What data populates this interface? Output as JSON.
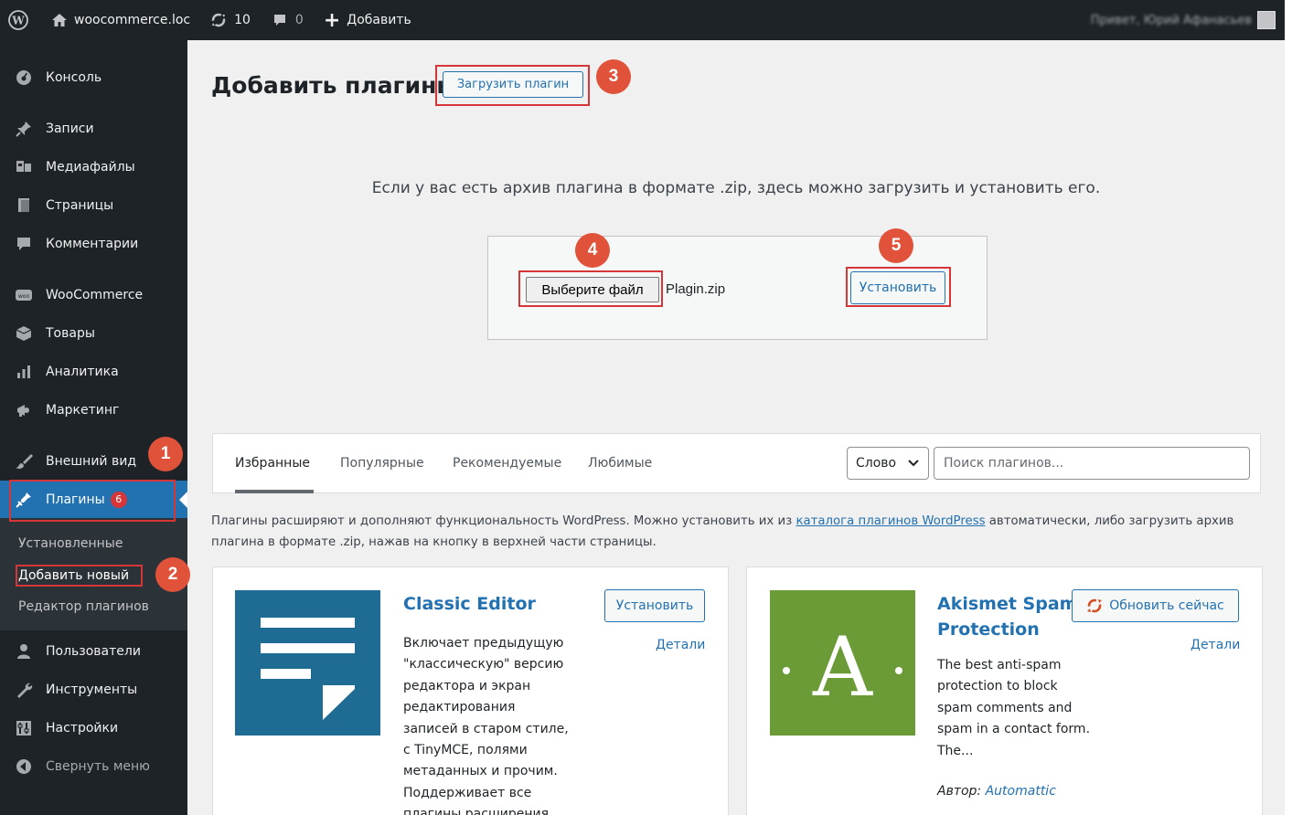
{
  "adminbar": {
    "site_name": "woocommerce.loc",
    "updates_count": "10",
    "comments_count": "0",
    "new_label": "Добавить",
    "greeting": "Привет, Юрий Афанасьев"
  },
  "sidebar": {
    "items": [
      {
        "label": "Консоль",
        "icon": "dashboard-icon"
      },
      {
        "label": "Записи",
        "icon": "pin-icon"
      },
      {
        "label": "Медиафайлы",
        "icon": "media-icon"
      },
      {
        "label": "Страницы",
        "icon": "pages-icon"
      },
      {
        "label": "Комментарии",
        "icon": "comment-icon"
      },
      {
        "label": "WooCommerce",
        "icon": "woo-icon"
      },
      {
        "label": "Товары",
        "icon": "products-icon"
      },
      {
        "label": "Аналитика",
        "icon": "analytics-icon"
      },
      {
        "label": "Маркетинг",
        "icon": "megaphone-icon"
      },
      {
        "label": "Внешний вид",
        "icon": "brush-icon"
      },
      {
        "label": "Плагины",
        "icon": "plugin-icon",
        "badge": "6"
      },
      {
        "label": "Пользователи",
        "icon": "users-icon"
      },
      {
        "label": "Инструменты",
        "icon": "wrench-icon"
      },
      {
        "label": "Настройки",
        "icon": "settings-icon"
      },
      {
        "label": "Свернуть меню",
        "icon": "collapse-icon"
      }
    ],
    "submenu": [
      "Установленные",
      "Добавить новый",
      "Редактор плагинов"
    ]
  },
  "markers": [
    "1",
    "2",
    "3",
    "4",
    "5"
  ],
  "page": {
    "title": "Добавить плагины",
    "upload_button": "Загрузить плагин",
    "upload_description": "Если у вас есть архив плагина в формате .zip, здесь можно загрузить и установить его.",
    "choose_file": "Выберите файл",
    "file_name": "Plagin.zip",
    "install_button": "Установить"
  },
  "filters": {
    "tabs": [
      "Избранные",
      "Популярные",
      "Рекомендуемые",
      "Любимые"
    ],
    "select_value": "Слово",
    "search_placeholder": "Поиск плагинов..."
  },
  "intro": {
    "before": "Плагины расширяют и дополняют функциональность WordPress. Можно установить их из ",
    "link": "каталога плагинов WordPress",
    "after": " автоматически, либо загрузить архив плагина в формате .zip, нажав на кнопку в верхней части страницы."
  },
  "plugins": [
    {
      "title": "Classic Editor",
      "action": "Установить",
      "details": "Детали",
      "description_lines": [
        "Включает предыдущую",
        "\"классическую\" версию",
        "редактора и экран",
        "редактирования",
        "записей в старом стиле,",
        "с TinyMCE, полями",
        "метаданных и прочим.",
        "Поддерживает все",
        "плагины расширения"
      ]
    },
    {
      "title_lines": [
        "Akismet Spam",
        "Protection"
      ],
      "action": "Обновить сейчас",
      "details": "Детали",
      "description_lines": [
        "The best anti-spam",
        "protection to block",
        "spam comments and",
        "spam in a contact form.",
        "The..."
      ],
      "author_label": "Автор:",
      "author": "Automattic"
    }
  ],
  "colors": {
    "sidebar_bg": "#1d2327",
    "accent": "#2271b1",
    "marker": "#e0523a",
    "highlight_box": "#d63638",
    "classic_editor_tile": "#1e6c93",
    "akismet_tile": "#6b9b37"
  }
}
